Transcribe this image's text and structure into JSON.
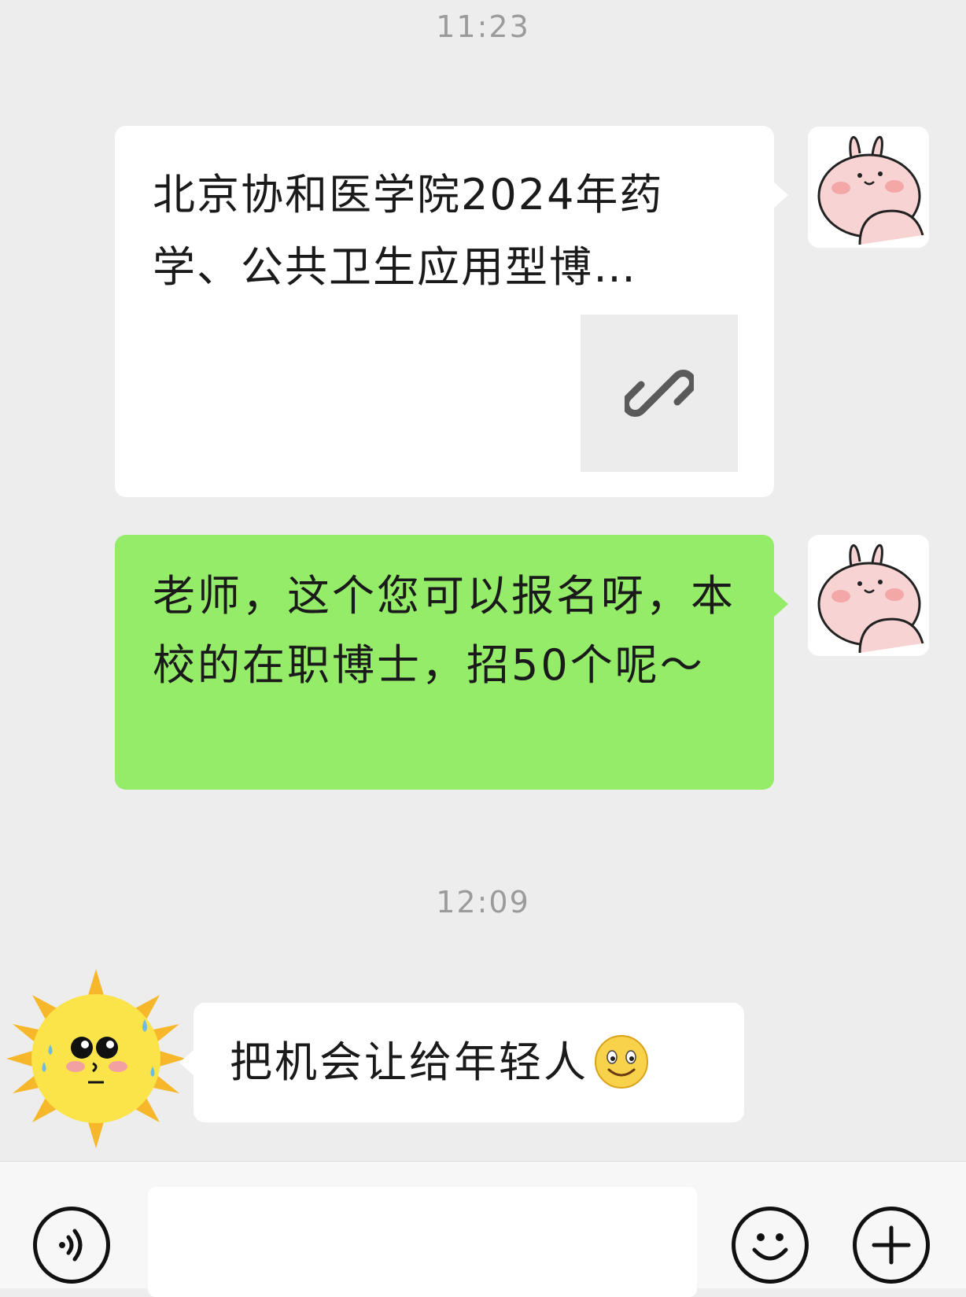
{
  "chat": {
    "timestamps": [
      "11:23",
      "12:09"
    ],
    "messages": [
      {
        "type": "link",
        "sender": "self",
        "title": "北京协和医学院2024年药学、公共卫生应用型博…",
        "thumbnail_icon": "link-icon",
        "bubble_color": "#ffffff"
      },
      {
        "type": "text",
        "sender": "self",
        "text": "老师，这个您可以报名呀，本校的在职博士，招50个呢～",
        "bubble_color": "#95ec69"
      },
      {
        "type": "text",
        "sender": "other",
        "text": "把机会让给年轻人",
        "emoji": "smile-emoji",
        "bubble_color": "#ffffff"
      }
    ],
    "avatars": {
      "self": "bunny-avatar",
      "other": "sun-avatar"
    }
  },
  "input_bar": {
    "value": "",
    "placeholder": "",
    "icons": [
      "voice-icon",
      "emoji-icon",
      "plus-icon"
    ]
  },
  "colors": {
    "background": "#ededed",
    "self_bubble": "#95ec69",
    "other_bubble": "#ffffff",
    "timestamp": "#9b9b9b"
  }
}
